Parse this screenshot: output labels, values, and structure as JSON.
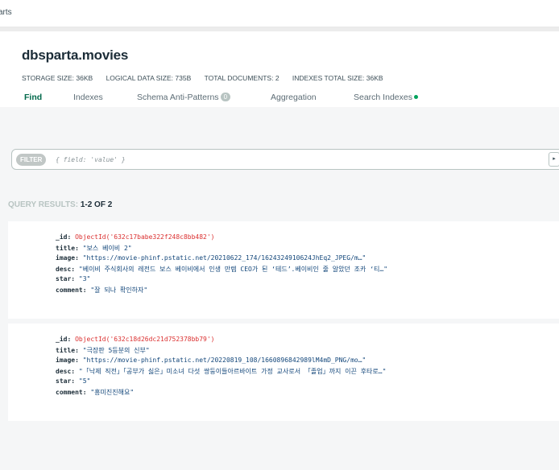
{
  "breadcrumb": "arts",
  "namespace": {
    "title": "dbsparta.movies"
  },
  "stats": {
    "storage_label": "STORAGE SIZE:",
    "storage_value": "36KB",
    "logical_label": "LOGICAL DATA SIZE:",
    "logical_value": "735B",
    "total_label": "TOTAL DOCUMENTS:",
    "total_value": "2",
    "indexes_label": "INDEXES TOTAL SIZE:",
    "indexes_value": "36KB"
  },
  "tabs": {
    "find": "Find",
    "indexes": "Indexes",
    "schema": "Schema Anti-Patterns",
    "schema_badge": "0",
    "aggregation": "Aggregation",
    "search": "Search Indexes"
  },
  "filter": {
    "label": "FILTER",
    "placeholder": "{ field: 'value' }",
    "expand": "▸"
  },
  "results": {
    "label": "QUERY RESULTS:",
    "value": "1-2 OF 2"
  },
  "documents": [
    {
      "id_key": "_id:",
      "id_value": "ObjectId('632c17babe322f248c8bb482')",
      "title_key": "title:",
      "title_value": "\"보스 베이비 2\"",
      "image_key": "image:",
      "image_value": "\"https://movie-phinf.pstatic.net/20210622_174/1624324910624JhEq2_JPEG/m…\"",
      "desc_key": "desc:",
      "desc_value": "\"베이비 주식회사의 레전드 보스 베이비에서 인생 만렙 CEO가 된 ‘테드’.베이비인 줄 알았던 조카 ‘티…\"",
      "star_key": "star:",
      "star_value": "\"3\"",
      "comment_key": "comment:",
      "comment_value": "\"잘 되나 확인하자\""
    },
    {
      "id_key": "_id:",
      "id_value": "ObjectId('632c18d26dc21d752378bb79')",
      "title_key": "title:",
      "title_value": "\"극장판 5등분의 신부\"",
      "image_key": "image:",
      "image_value": "\"https://movie-phinf.pstatic.net/20220819_108/1660896842989lM4mD_PNG/mo…\"",
      "desc_key": "desc:",
      "desc_value": "\"「낙제 직전」「공부가 싫은」미소녀 다섯 쌍둥이들아르바이트 가정 교사로서 「졸업」까지 이끈 후타로…\"",
      "star_key": "star:",
      "star_value": "\"5\"",
      "comment_key": "comment:",
      "comment_value": "\"흥미진진해요\""
    }
  ]
}
